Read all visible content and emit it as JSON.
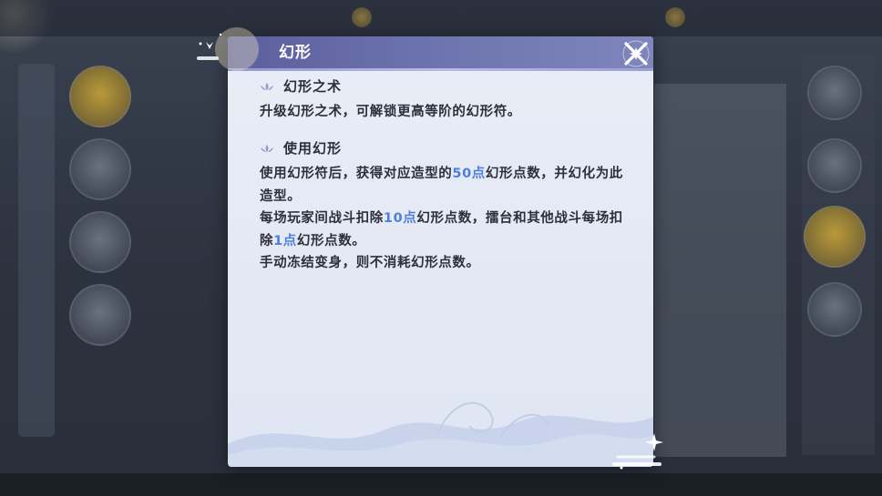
{
  "dialog": {
    "title": "幻形",
    "close_icon": "x-cross-icon"
  },
  "sections": [
    {
      "heading": "幻形之术",
      "paragraphs": [
        [
          "升级幻形之术，可解锁更高等阶的幻形符。"
        ]
      ]
    },
    {
      "heading": "使用幻形",
      "paragraphs": [
        [
          "使用幻形符后，获得对应造型的",
          "50点",
          "幻形点数，并幻化为此造型。"
        ],
        [
          "每场玩家间战斗扣除",
          "10点",
          "幻形点数，擂台和其他战斗每场扣除",
          "1点",
          "幻形点数。"
        ],
        [
          "手动冻结变身，则不消耗幻形点数。"
        ]
      ]
    }
  ],
  "colors": {
    "header_bg": "#6c72ad",
    "panel_bg": "#e6ebf5",
    "text": "#2b303b",
    "highlight": "#4d7fe0"
  }
}
